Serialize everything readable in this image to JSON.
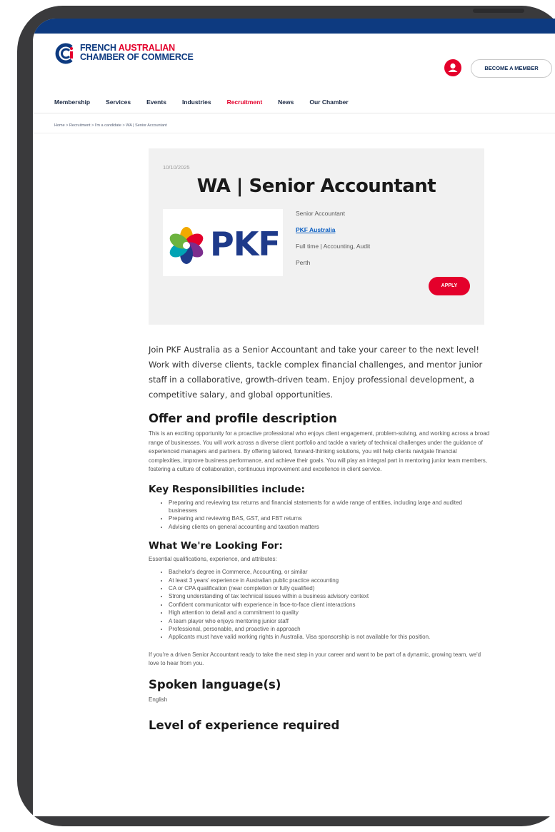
{
  "header": {
    "logo_line1_blue": "FRENCH ",
    "logo_line1_red": "AUSTRALIAN",
    "logo_line2": "CHAMBER OF COMMERCE",
    "member_button": "BECOME A MEMBER"
  },
  "nav": [
    "Membership",
    "Services",
    "Events",
    "Industries",
    "Recruitment",
    "News",
    "Our Chamber"
  ],
  "nav_active": "Recruitment",
  "breadcrumb": "Home > Recruitment > I'm a candidate > WA | Senior Accountant",
  "job": {
    "date": "10/10/2025",
    "title": "WA | Senior Accountant",
    "logo_text": "PKF",
    "position": "Senior Accountant",
    "company": "PKF Australia",
    "type": "Full time | Accounting, Audit",
    "location": "Perth",
    "apply": "APPLY"
  },
  "article": {
    "intro": "Join PKF Australia as a Senior Accountant and take your career to the next level! Work with diverse clients, tackle complex financial challenges, and mentor junior staff in a collaborative, growth-driven team. Enjoy professional development, a competitive salary, and global opportunities.",
    "offer_heading": "Offer and profile description",
    "offer_text": "This is an exciting opportunity for a proactive professional who enjoys client engagement, problem-solving, and working across a broad range of businesses. You will work across a diverse client portfolio and tackle a variety of technical challenges under the guidance of experienced managers and partners. By offering tailored, forward-thinking solutions, you will help clients navigate financial complexities, improve business performance, and achieve their goals. You will play an integral part in mentoring junior team members, fostering a culture of collaboration, continuous improvement and excellence in client service.",
    "resp_heading": "Key Responsibilities include:",
    "responsibilities": [
      "Preparing and reviewing tax returns and financial statements for a wide range of entities, including large and audited businesses",
      "Preparing and reviewing BAS, GST, and FBT returns",
      "Advising clients on general accounting and taxation matters"
    ],
    "looking_heading": "What We're Looking For:",
    "looking_intro": "Essential qualifications, experience, and attributes:",
    "requirements": [
      "Bachelor's degree in Commerce, Accounting, or similar",
      "At least 3 years' experience in Australian public practice accounting",
      "CA or CPA qualification (near completion or fully qualified)",
      "Strong understanding of tax technical issues within a business advisory context",
      "Confident communicator with experience in face-to-face client interactions",
      "High attention to detail and a commitment to quality",
      "A team player who enjoys mentoring junior staff",
      "Professional, personable, and proactive in approach",
      "Applicants must have valid working rights in Australia. Visa sponsorship is not available for this position."
    ],
    "closing": "If you're a driven Senior Accountant ready to take the next step in your career and want to be part of a dynamic, growing team, we'd love to hear from you.",
    "language_heading": "Spoken language(s)",
    "language": "English",
    "experience_heading": "Level of experience required"
  },
  "colors": {
    "brand_blue": "#0d3a80",
    "brand_red": "#e4002b",
    "card_bg": "#f1f1f1"
  }
}
